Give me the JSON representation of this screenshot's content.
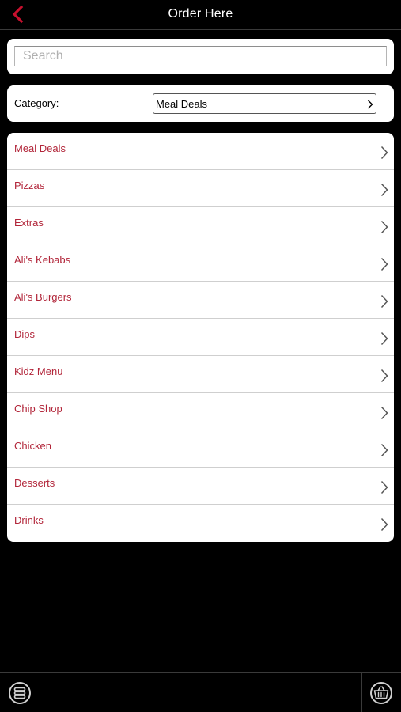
{
  "header": {
    "title": "Order Here",
    "back_icon": "chevron-left-icon",
    "accent_color": "#c8102e"
  },
  "search": {
    "placeholder": "Search",
    "value": ""
  },
  "category": {
    "label": "Category:",
    "selected": "Meal Deals"
  },
  "menu_list": {
    "item_color": "#b2263a",
    "items": [
      {
        "label": "Meal Deals"
      },
      {
        "label": "Pizzas"
      },
      {
        "label": "Extras"
      },
      {
        "label": "Ali's Kebabs"
      },
      {
        "label": "Ali's Burgers"
      },
      {
        "label": "Dips"
      },
      {
        "label": "Kidz Menu"
      },
      {
        "label": "Chip Shop"
      },
      {
        "label": "Chicken"
      },
      {
        "label": "Desserts"
      },
      {
        "label": "Drinks"
      }
    ]
  },
  "footer": {
    "left_icon": "menu-stack-icon",
    "right_icon": "basket-icon"
  }
}
